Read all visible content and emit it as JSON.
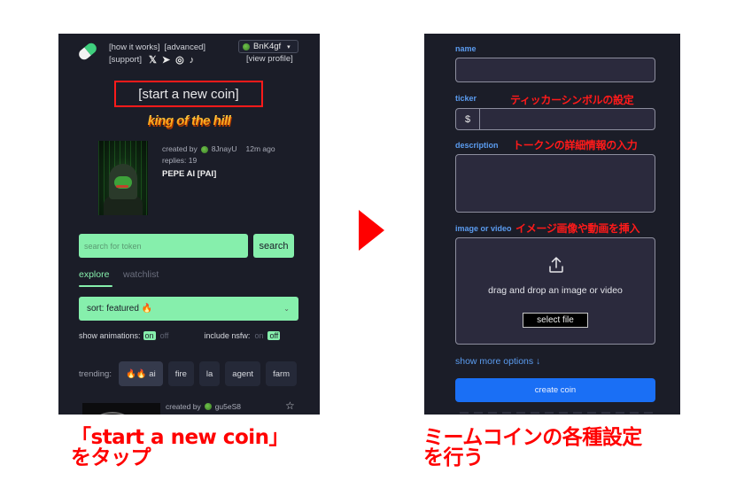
{
  "left_screen": {
    "nav": {
      "how_it_works": "[how it works]",
      "advanced": "[advanced]",
      "support": "[support]",
      "social_icons": [
        "x-icon",
        "telegram-icon",
        "instagram-icon",
        "tiktok-icon"
      ],
      "social_glyphs": [
        "𝕏",
        "➤",
        "◎",
        "♪"
      ]
    },
    "wallet": {
      "label": "BnK4gf",
      "caret": "▾",
      "view_profile": "[view profile]"
    },
    "start_new_coin": "[start a new coin]",
    "king_of_the_hill": "king of the hill",
    "featured_coin": {
      "created_by_label": "created by",
      "creator": "8JnayU",
      "time_ago": "12m ago",
      "replies": "replies: 19",
      "name": "PEPE AI [PAI]"
    },
    "search": {
      "placeholder": "search for token",
      "button": "search"
    },
    "tabs": [
      {
        "label": "explore",
        "active": true
      },
      {
        "label": "watchlist",
        "active": false
      }
    ],
    "sort": {
      "value": "sort: featured 🔥",
      "chevron": "⌄"
    },
    "toggles": {
      "show_animations_label": "show animations:",
      "show_animations_on": "on",
      "show_animations_off": "off",
      "show_animations_value": "on",
      "include_nsfw_label": "include nsfw:",
      "include_nsfw_on": "on",
      "include_nsfw_off": "off",
      "include_nsfw_value": "off"
    },
    "trending": {
      "label": "trending:",
      "chips": [
        "🔥🔥 ai",
        "fire",
        "la",
        "agent",
        "farm"
      ]
    },
    "second_coin": {
      "created_by_label": "created by",
      "creator": "gu5eS8",
      "star": "☆"
    }
  },
  "right_screen": {
    "fields": {
      "name_label": "name",
      "ticker_label": "ticker",
      "ticker_prefix": "$",
      "description_label": "description",
      "image_label": "image or video"
    },
    "upload": {
      "text": "drag and drop an image or video",
      "button": "select file"
    },
    "show_more": "show more options ↓",
    "create_button": "create coin"
  },
  "annotations": {
    "ticker": "ティッカーシンボルの設定",
    "description": "トークンの詳細情報の入力",
    "image": "イメージ画像や動画を挿入"
  },
  "captions": {
    "left_line1": "「start a new coin」",
    "left_line2": "をタップ",
    "right_line1": "ミームコインの各種設定",
    "right_line2": "を行う"
  },
  "colors": {
    "panel_bg": "#1b1d28",
    "accent_green": "#86efac",
    "accent_blue": "#1a6ff5",
    "label_blue": "#5b9cf0",
    "annotation_red": "#ff0000"
  }
}
